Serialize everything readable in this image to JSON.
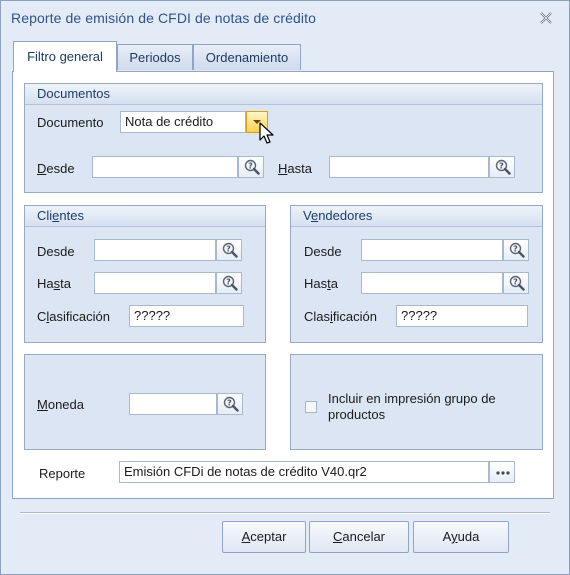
{
  "window": {
    "title": "Reporte de emisión de CFDI de notas de crédito"
  },
  "tabs": [
    {
      "label": "Filtro general"
    },
    {
      "label": "Periodos"
    },
    {
      "label": "Ordenamiento"
    }
  ],
  "documentos": {
    "title": "Documentos",
    "documento_label": "Documento",
    "documento_value": "Nota de crédito",
    "desde_label_first": "D",
    "desde_label_rest": "esde",
    "hasta_label_first": "H",
    "hasta_label_rest": "asta",
    "desde_value": "",
    "hasta_value": ""
  },
  "clientes": {
    "title_pre": "Cli",
    "title_u": "e",
    "title_post": "ntes",
    "desde_label": "Desde",
    "hasta_pre": "Ha",
    "hasta_u": "s",
    "hasta_post": "ta",
    "clasif_pre": "C",
    "clasif_u": "l",
    "clasif_post": "asificación",
    "clasif_value": "?????"
  },
  "vendedores": {
    "title_pre": "V",
    "title_u": "e",
    "title_post": "ndedores",
    "desde_label": "Desde",
    "hasta_pre": "Has",
    "hasta_u": "t",
    "hasta_post": "a",
    "clasif_pre": "Clas",
    "clasif_u": "i",
    "clasif_post": "ficación",
    "clasif_value": "?????"
  },
  "moneda": {
    "label_u": "M",
    "label_rest": "oneda",
    "value": ""
  },
  "incluir": {
    "line1": "Incluir en impresión grupo de",
    "line2": "productos",
    "checked": false
  },
  "reporte": {
    "label": "Reporte",
    "value": "Emisión CFDi de notas de crédito V40.qr2"
  },
  "buttons": {
    "aceptar_u": "A",
    "aceptar_rest": "ceptar",
    "cancelar_u": "C",
    "cancelar_rest": "ancelar",
    "ayuda_pre": "A",
    "ayuda_u": "y",
    "ayuda_post": "uda"
  },
  "icons": {
    "close": "close-icon",
    "lookup": "magnifier-question-icon",
    "dropdown": "chevron-down-icon",
    "ellipsis": "ellipsis-icon",
    "cursor": "mouse-pointer-icon"
  },
  "colors": {
    "title_text": "#31528a",
    "window_bg": "#e3ebf6",
    "group_bg": "#dbe5f3",
    "dropdown_accent": "#ffd24f"
  }
}
